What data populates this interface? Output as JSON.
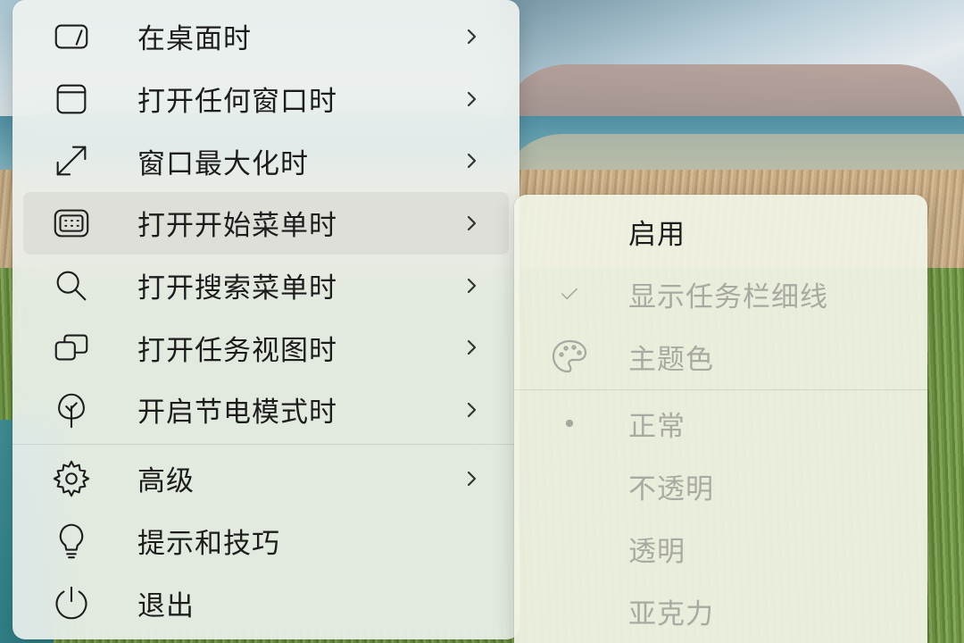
{
  "main_menu": {
    "items": [
      {
        "label": "在桌面时",
        "icon": "desktop-icon",
        "has_submenu": true
      },
      {
        "label": "打开任何窗口时",
        "icon": "window-icon",
        "has_submenu": true
      },
      {
        "label": "窗口最大化时",
        "icon": "maximize-icon",
        "has_submenu": true
      },
      {
        "label": "打开开始菜单时",
        "icon": "start-menu-icon",
        "has_submenu": true,
        "active": true
      },
      {
        "label": "打开搜索菜单时",
        "icon": "search-icon",
        "has_submenu": true
      },
      {
        "label": "打开任务视图时",
        "icon": "task-view-icon",
        "has_submenu": true
      },
      {
        "label": "开启节电模式时",
        "icon": "leaf-icon",
        "has_submenu": true
      }
    ],
    "secondary": [
      {
        "label": "高级",
        "icon": "gear-icon",
        "has_submenu": true
      },
      {
        "label": "提示和技巧",
        "icon": "lightbulb-icon",
        "has_submenu": false
      },
      {
        "label": "退出",
        "icon": "power-icon",
        "has_submenu": false
      }
    ]
  },
  "submenu": {
    "items": [
      {
        "label": "启用",
        "enabled": true,
        "mark": ""
      },
      {
        "label": "显示任务栏细线",
        "enabled": false,
        "mark": "checkmark-icon"
      },
      {
        "label": "主题色",
        "enabled": false,
        "mark": "palette-icon"
      }
    ],
    "styles": [
      {
        "label": "正常",
        "enabled": false,
        "mark": "bullet-icon"
      },
      {
        "label": "不透明",
        "enabled": false,
        "mark": ""
      },
      {
        "label": "透明",
        "enabled": false,
        "mark": ""
      },
      {
        "label": "亚克力",
        "enabled": false,
        "mark": ""
      }
    ]
  },
  "colors": {
    "text_primary": "#1c1c1c",
    "text_disabled": "#a8aaa2",
    "menu_bg": "#eef3f0",
    "submenu_bg": "#f0f3e4",
    "active_item_bg": "#e3e6e2"
  }
}
